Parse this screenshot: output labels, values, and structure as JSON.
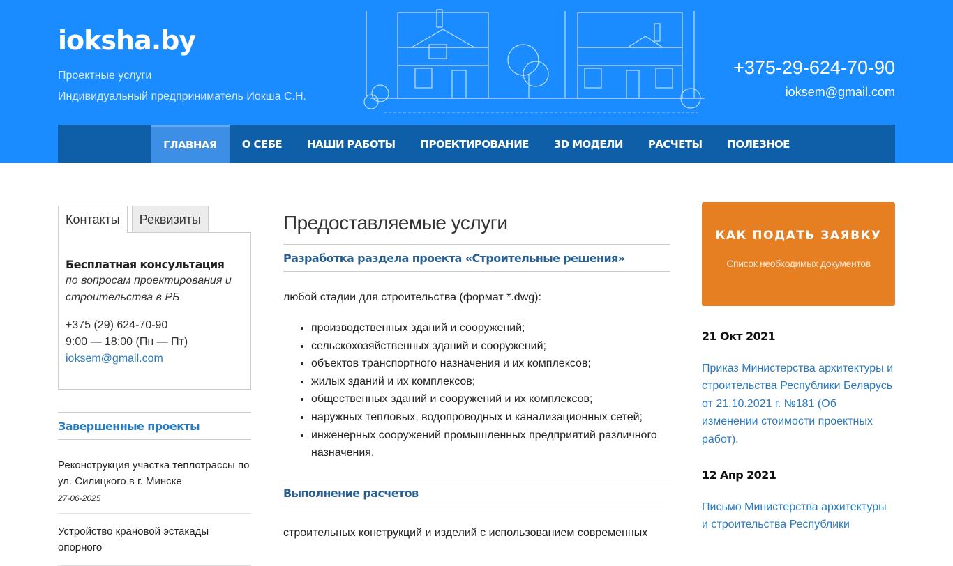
{
  "header": {
    "site_title": "ioksha.by",
    "tagline1": "Проектные услуги",
    "tagline2": "Индивидуальный предприниматель Иокша С.Н.",
    "phone": "+375-29-624-70-90",
    "email": "ioksem@gmail.com"
  },
  "nav": {
    "items": [
      "ГЛАВНАЯ",
      "О СЕБЕ",
      "НАШИ РАБОТЫ",
      "ПРОЕКТИРОВАНИЕ",
      "3D МОДЕЛИ",
      "РАСЧЕТЫ",
      "ПОЛЕЗНОЕ"
    ],
    "active": "ГЛАВНАЯ"
  },
  "sidebar": {
    "tabs": [
      "Контакты",
      "Реквизиты"
    ],
    "contact": {
      "title": "Бесплатная консультация",
      "subtitle": "по вопросам проектирования и строительства в РБ",
      "phone": "+375 (29) 624-70-90",
      "hours": "9:00 — 18:00 (Пн — Пт)",
      "email": "ioksem@gmail.com"
    },
    "projects_title": "Завершенные проекты",
    "projects": [
      {
        "title": "Реконструкция участка теплотрассы по ул. Силицкого в г. Минске",
        "date": "27-06-2025"
      },
      {
        "title": "Устройство крановой эстакады опорного",
        "date": ""
      }
    ]
  },
  "main": {
    "title": "Предоставляемые услуги",
    "section1_title": "Разработка раздела проекта «Строительные решения»",
    "section1_intro": "любой стадии для строительства (формат *.dwg):",
    "section1_items": [
      "производственных зданий и сооружений;",
      "сельскохозяйственных зданий и сооружений;",
      "объектов транспортного назначения и их комплексов;",
      "жилых зданий и их комплексов;",
      "общественных зданий и сооружений и их комплексов;",
      "наружных тепловых, водопроводных и канализационных сетей;",
      "инженерных сооружений промышленных предприятий различного назначения."
    ],
    "section2_title": "Выполнение расчетов",
    "section2_intro": "строительных конструкций и изделий с использованием современных"
  },
  "right": {
    "cta_title": "КАК ПОДАТЬ ЗАЯВКУ",
    "cta_sub": "Список необходимых документов",
    "news": [
      {
        "date": "21 Окт 2021",
        "text": "Приказ Министерства архитектуры и строительства Республики Беларусь от 21.10.2021 г. №181 (Об изменении стоимости проектных работ)."
      },
      {
        "date": "12 Апр 2021",
        "text": "Письмо Министерства архитектуры и строительства Республики"
      }
    ]
  },
  "colors": {
    "header_bg": "#1a8cff",
    "nav_bg": "#0f5fa8",
    "nav_active": "#3d8fe6",
    "cta_bg": "#e67e22",
    "link": "#2a7ac0"
  }
}
